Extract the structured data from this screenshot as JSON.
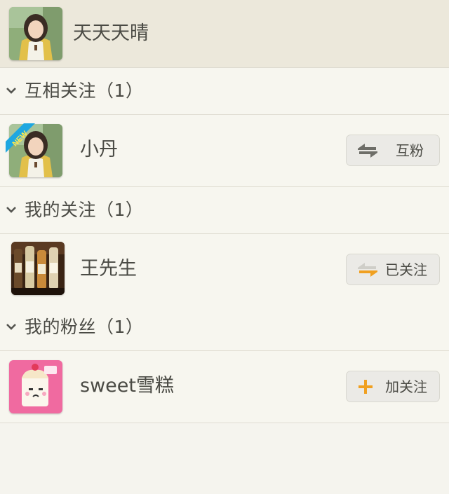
{
  "colors": {
    "background": "#f5f4ee",
    "header_bg": "#ece8db",
    "accent_orange": "#f0a020",
    "button_bg": "#ebeae6",
    "text": "#4a4a44"
  },
  "header": {
    "user_name": "天天天晴",
    "avatar": "user-photo-avatar"
  },
  "sections": [
    {
      "title": "互相关注（1）",
      "icon": "chevron-down-icon",
      "items": [
        {
          "name": "小丹",
          "avatar": "user-photo-avatar",
          "badge": "NEW",
          "button_label": "互粉",
          "button_icon": "mutual-follow-arrows-icon"
        }
      ]
    },
    {
      "title": "我的关注（1）",
      "icon": "chevron-down-icon",
      "items": [
        {
          "name": "王先生",
          "avatar": "wine-bottles-avatar",
          "button_label": "已关注",
          "button_icon": "followed-arrows-icon"
        }
      ]
    },
    {
      "title": "我的粉丝（1）",
      "icon": "chevron-down-icon",
      "items": [
        {
          "name": "sweet雪糕",
          "avatar": "cartoon-cake-avatar",
          "button_label": "加关注",
          "button_icon": "plus-icon"
        }
      ]
    }
  ]
}
